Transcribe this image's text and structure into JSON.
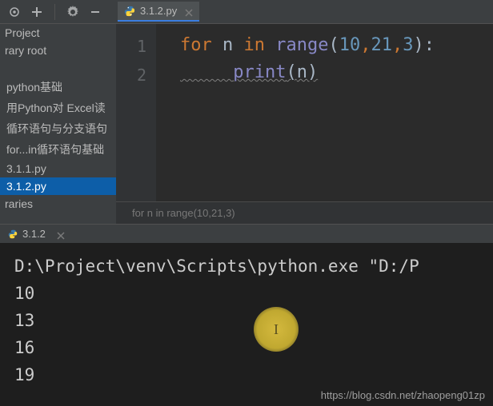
{
  "tab": {
    "label": "3.1.2.py"
  },
  "sidebar": {
    "items": [
      {
        "label": "Project"
      },
      {
        "label": "rary root"
      },
      {
        "label": "python基础"
      },
      {
        "label": "用Python对 Excel读"
      },
      {
        "label": "循环语句与分支语句"
      },
      {
        "label": "for...in循环语句基础"
      },
      {
        "label": "3.1.1.py"
      },
      {
        "label": "3.1.2.py"
      },
      {
        "label": "raries"
      }
    ]
  },
  "editor": {
    "lines": {
      "l1": "1",
      "l2": "2"
    },
    "code": {
      "for": "for",
      "n": "n",
      "in": "in",
      "range": "range",
      "lp1": "(",
      "a1": "10",
      "c1": ",",
      "a2": "21",
      "c2": ",",
      "a3": "3",
      "rp1": ")",
      "colon": ":",
      "print": "print",
      "lp2": "(",
      "pn": "n",
      "rp2": ")"
    }
  },
  "breadcrumb": "for n in range(10,21,3)",
  "run_tab": {
    "label": "3.1.2"
  },
  "console": {
    "cmd": "D:\\Project\\venv\\Scripts\\python.exe \"D:/P",
    "out": [
      "10",
      "13",
      "16",
      "19"
    ]
  },
  "cursor_glyph": "I",
  "watermark": "https://blog.csdn.net/zhaopeng01zp"
}
